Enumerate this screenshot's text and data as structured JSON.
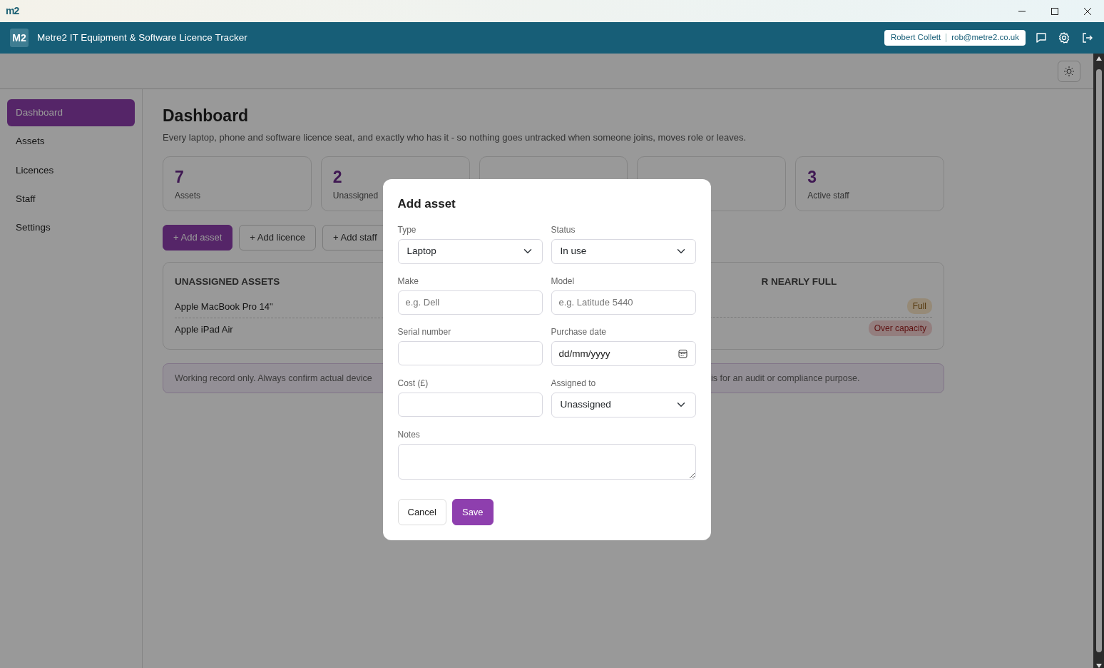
{
  "window": {
    "app_icon": "m2"
  },
  "header": {
    "logo": "M2",
    "title": "Metre2 IT Equipment & Software Licence Tracker",
    "user_name": "Robert Collett",
    "user_email": "rob@metre2.co.uk"
  },
  "sidebar": {
    "items": [
      {
        "label": "Dashboard",
        "selected": true
      },
      {
        "label": "Assets",
        "selected": false
      },
      {
        "label": "Licences",
        "selected": false
      },
      {
        "label": "Staff",
        "selected": false
      },
      {
        "label": "Settings",
        "selected": false
      }
    ]
  },
  "page": {
    "title": "Dashboard",
    "subtitle": "Every laptop, phone and software licence seat, and exactly who has it - so nothing goes untracked when someone joins, moves role or leaves.",
    "stats": [
      {
        "kind": "stat",
        "value": "7",
        "label": "Assets"
      },
      {
        "kind": "stat",
        "value": "2",
        "label": "Unassigned"
      },
      {
        "kind": "covered"
      },
      {
        "kind": "covered"
      },
      {
        "kind": "stat",
        "value": "3",
        "label": "Active staff"
      }
    ],
    "actions": [
      {
        "label": "+ Add asset",
        "kind": "primary"
      },
      {
        "label": "+ Add licence",
        "kind": "outline"
      },
      {
        "label": "+ Add staff",
        "kind": "outline"
      }
    ],
    "unassigned_panel": {
      "title": "UNASSIGNED ASSETS",
      "items": [
        "Apple MacBook Pro 14\"",
        "Apple iPad Air"
      ]
    },
    "capacity_panel": {
      "title": "R NEARLY FULL",
      "badges": [
        {
          "text": "Full",
          "kind": "full"
        },
        {
          "text": "Over capacity",
          "kind": "over"
        }
      ]
    },
    "notice": {
      "left": "Working record only. Always confirm actual device",
      "right": "is for an audit or compliance purpose."
    }
  },
  "modal": {
    "title": "Add asset",
    "fields": [
      {
        "label": "Type",
        "kind": "select",
        "value": "Laptop"
      },
      {
        "label": "Status",
        "kind": "select",
        "value": "In use"
      },
      {
        "label": "Make",
        "kind": "text",
        "placeholder": "e.g. Dell"
      },
      {
        "label": "Model",
        "kind": "text",
        "placeholder": "e.g. Latitude 5440"
      },
      {
        "label": "Serial number",
        "kind": "text"
      },
      {
        "label": "Purchase date",
        "kind": "date",
        "placeholder": "dd/mm/yyyy"
      },
      {
        "label": "Cost (£)",
        "kind": "text"
      },
      {
        "label": "Assigned to",
        "kind": "select",
        "value": "Unassigned"
      },
      {
        "label": "Notes",
        "kind": "textarea"
      }
    ],
    "buttons": [
      {
        "label": "Cancel",
        "kind": "secondary"
      },
      {
        "label": "Save",
        "kind": "primary"
      }
    ]
  }
}
